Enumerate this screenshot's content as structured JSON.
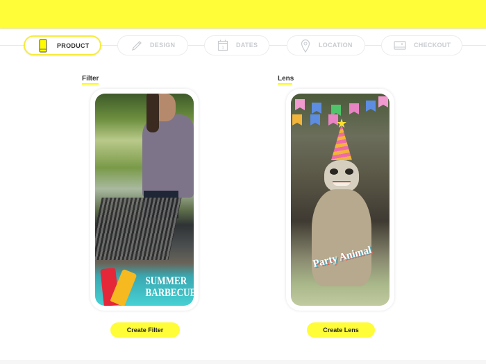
{
  "colors": {
    "brand_yellow": "#fffc38",
    "active_border": "#f7ec3a",
    "inactive_text": "#c8cbd0"
  },
  "stepper": {
    "steps": [
      {
        "label": "PRODUCT",
        "icon": "phone-icon",
        "active": true
      },
      {
        "label": "DESIGN",
        "icon": "pencil-icon",
        "active": false
      },
      {
        "label": "DATES",
        "icon": "calendar-icon",
        "active": false
      },
      {
        "label": "LOCATION",
        "icon": "map-pin-icon",
        "active": false
      },
      {
        "label": "CHECKOUT",
        "icon": "credit-card-icon",
        "active": false
      }
    ]
  },
  "products": [
    {
      "section_label": "Filter",
      "preview_caption_line1": "SUMMER",
      "preview_caption_line2": "BARBECUE",
      "button_label": "Create Filter"
    },
    {
      "section_label": "Lens",
      "preview_caption": "Party Animal",
      "button_label": "Create Lens"
    }
  ]
}
